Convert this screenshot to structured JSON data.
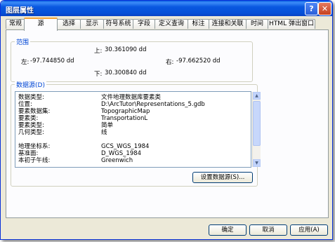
{
  "window": {
    "title": "图层属性",
    "help_label": "?",
    "close_label": "✕"
  },
  "tabs": [
    {
      "label": "常规"
    },
    {
      "label": "源"
    },
    {
      "label": "选择"
    },
    {
      "label": "显示"
    },
    {
      "label": "符号系统"
    },
    {
      "label": "字段"
    },
    {
      "label": "定义查询"
    },
    {
      "label": "标注"
    },
    {
      "label": "连接和关联"
    },
    {
      "label": "时间"
    },
    {
      "label": "HTML 弹出窗口"
    }
  ],
  "extent": {
    "title": "范围",
    "top_label": "上:",
    "top_value": "30.361090 dd",
    "left_label": "左:",
    "left_value": "-97.744850 dd",
    "right_label": "右:",
    "right_value": "-97.662520 dd",
    "bottom_label": "下:",
    "bottom_value": "30.300840 dd"
  },
  "datasource": {
    "title": "数据源(D)",
    "rows": [
      {
        "key": "数据类型:",
        "value": "文件地理数据库要素类"
      },
      {
        "key": "位置:",
        "value": "D:\\ArcTutor\\Representations_5.gdb"
      },
      {
        "key": "要素数据集:",
        "value": "TopographicMap"
      },
      {
        "key": "要素类:",
        "value": "TransportationL"
      },
      {
        "key": "要素类型:",
        "value": "简单"
      },
      {
        "key": "几何类型:",
        "value": "线"
      },
      {
        "key": "",
        "value": ""
      },
      {
        "key": "地理坐标系:",
        "value": "GCS_WGS_1984"
      },
      {
        "key": "基准面:",
        "value": "D_WGS_1984"
      },
      {
        "key": "本初子午线:",
        "value": "Greenwich"
      }
    ],
    "set_button": "设置数据源(S)..."
  },
  "footer": {
    "ok": "确定",
    "cancel": "取消",
    "apply": "应用(A)"
  }
}
